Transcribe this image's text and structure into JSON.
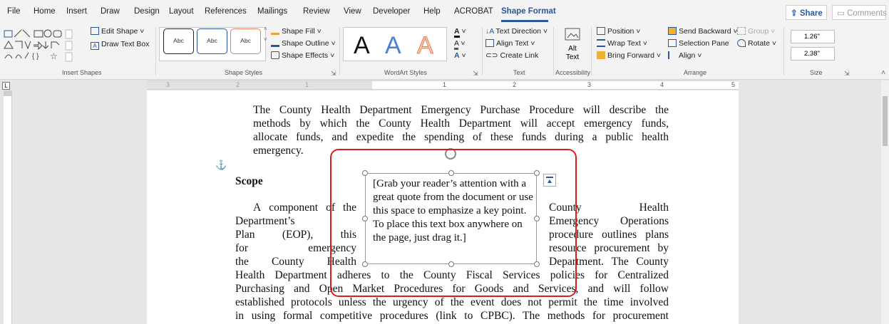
{
  "menu": {
    "tabs": [
      "File",
      "Home",
      "Insert",
      "Draw",
      "Design",
      "Layout",
      "References",
      "Mailings",
      "Review",
      "View",
      "Developer",
      "Help",
      "ACROBAT",
      "Shape Format"
    ],
    "active_tab": "Shape Format",
    "share": "Share",
    "comments": "Comments"
  },
  "ribbon": {
    "insert_shapes": {
      "edit_shape": "Edit Shape",
      "draw_text_box": "Draw Text Box",
      "label": "Insert Shapes"
    },
    "shape_styles": {
      "sample": "Abc",
      "shape_fill": "Shape Fill",
      "shape_outline": "Shape Outline",
      "shape_effects": "Shape Effects",
      "label": "Shape Styles"
    },
    "wordart_styles": {
      "sample": "A",
      "label": "WordArt Styles"
    },
    "text": {
      "text_direction": "Text Direction",
      "align_text": "Align Text",
      "create_link": "Create Link",
      "label": "Text"
    },
    "accessibility": {
      "alt_text_line1": "Alt",
      "alt_text_line2": "Text",
      "label": "Accessibility"
    },
    "arrange": {
      "position": "Position",
      "wrap_text": "Wrap Text",
      "bring_forward": "Bring Forward",
      "send_backward": "Send Backward",
      "selection_pane": "Selection Pane",
      "align": "Align",
      "group": "Group",
      "rotate": "Rotate",
      "label": "Arrange"
    },
    "size": {
      "height": "1.26\"",
      "width": "2.38\"",
      "label": "Size"
    }
  },
  "ruler": {
    "numbers": [
      "3",
      "2",
      "1",
      "1",
      "2",
      "3",
      "4",
      "5"
    ]
  },
  "document": {
    "intro_lines": [
      "The County Health Department Emergency Purchase Procedure will describe the",
      "methods by which the County Health Department will accept emergency funds,",
      "allocate funds, and expedite the spending of these funds during a public health"
    ],
    "intro_last": "emergency.",
    "heading": "Scope",
    "left_col": [
      [
        "A",
        "component",
        "of",
        "the"
      ],
      [
        "Department’s"
      ],
      [
        "Plan",
        "(EOP),",
        "this"
      ],
      [
        "for",
        "emergency"
      ],
      [
        "the",
        "County",
        "Health"
      ]
    ],
    "right_col": [
      [
        "County",
        "Health"
      ],
      [
        "Emergency",
        "Operations"
      ],
      [
        "procedure",
        "outlines",
        "plans"
      ],
      [
        "resource",
        "procurement",
        "by"
      ],
      [
        "Department.",
        "The",
        "County"
      ]
    ],
    "full_lines": [
      "Health Department adheres to the  County Fiscal Services policies for Centralized",
      "Purchasing and Open Market Procedures for Goods and Services, and will follow",
      "established protocols unless the urgency of the event does not permit the time involved",
      "in using formal competitive procedures (link to CPBC). The methods for procurement"
    ],
    "textbox_text": "[Grab your reader’s attention with a great quote from the document or use this space to emphasize a key point. To place this text box anywhere on the page, just drag it.]"
  },
  "colors": {
    "accent": "#2b579a",
    "annotation": "#e01b1b"
  }
}
